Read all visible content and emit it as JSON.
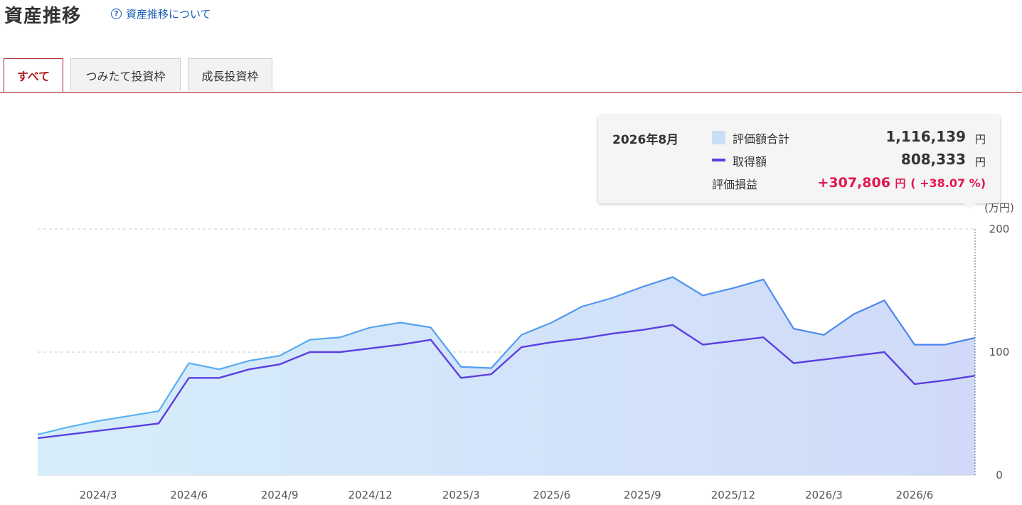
{
  "header": {
    "title": "資産推移",
    "help_label": "資産推移について"
  },
  "tabs": [
    {
      "label": "すべて",
      "active": true
    },
    {
      "label": "つみたて投資枠",
      "active": false
    },
    {
      "label": "成長投資枠",
      "active": false
    }
  ],
  "tooltip": {
    "date": "2026年8月",
    "valuation_label": "評価額合計",
    "valuation_value": "1,116,139",
    "cost_label": "取得額",
    "cost_value": "808,333",
    "gain_label": "評価損益",
    "gain_value": "+307,806",
    "gain_pct": "( +38.07 %)",
    "unit": "円"
  },
  "chart_data": {
    "type": "area",
    "title": "",
    "unit_label": "(万円)",
    "ylim": [
      0,
      200
    ],
    "yticks": [
      0,
      100,
      200
    ],
    "x": [
      "2024/1",
      "2024/2",
      "2024/3",
      "2024/4",
      "2024/5",
      "2024/6",
      "2024/7",
      "2024/8",
      "2024/9",
      "2024/10",
      "2024/11",
      "2024/12",
      "2025/1",
      "2025/2",
      "2025/3",
      "2025/4",
      "2025/5",
      "2025/6",
      "2025/7",
      "2025/8",
      "2025/9",
      "2025/10",
      "2025/11",
      "2025/12",
      "2026/1",
      "2026/2",
      "2026/3",
      "2026/4",
      "2026/5",
      "2026/6",
      "2026/7",
      "2026/8"
    ],
    "xtick_labels": [
      "2024/3",
      "2024/6",
      "2024/9",
      "2024/12",
      "2025/3",
      "2025/6",
      "2025/9",
      "2025/12",
      "2026/3",
      "2026/6"
    ],
    "series": [
      {
        "name": "評価額合計",
        "type": "area",
        "values": [
          33,
          39,
          44,
          48,
          52,
          91,
          86,
          93,
          97,
          110,
          112,
          120,
          124,
          120,
          88,
          87,
          114,
          124,
          137,
          144,
          153,
          161,
          146,
          152,
          159,
          119,
          114,
          131,
          142,
          106,
          106,
          111.6
        ]
      },
      {
        "name": "取得額",
        "type": "line",
        "values": [
          30,
          33,
          36,
          39,
          42,
          79,
          79,
          86,
          90,
          100,
          100,
          103,
          106,
          110,
          79,
          82,
          104,
          108,
          111,
          115,
          118,
          122,
          106,
          109,
          112,
          91,
          94,
          97,
          100,
          74,
          77,
          80.8
        ]
      }
    ],
    "grid": true,
    "colors": {
      "area_line": "#4a8ff0",
      "area_fill_start": "#d6eefb",
      "area_fill_end": "#d0daf8",
      "cost_line": "#5b3fe0"
    }
  }
}
